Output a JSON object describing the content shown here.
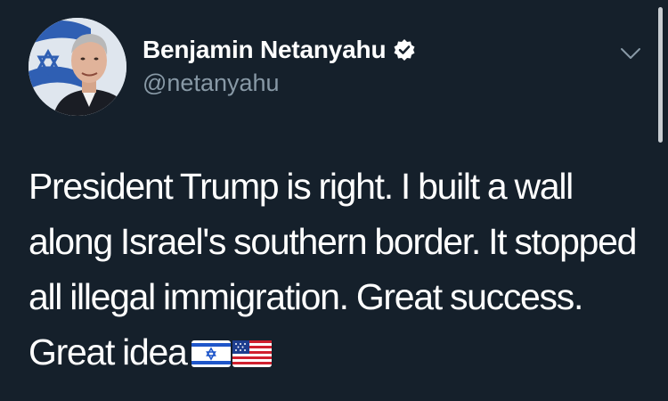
{
  "tweet": {
    "author": {
      "display_name": "Benjamin Netanyahu",
      "handle": "@netanyahu",
      "verified": true,
      "avatar_icon": "portrait-with-israeli-flag"
    },
    "text": "President Trump is right. I built a wall along Israel's southern border. It stopped all illegal immigration. Great success. Great idea",
    "emojis": [
      "israel-flag-emoji",
      "us-flag-emoji"
    ],
    "menu_icon": "chevron-down-icon"
  },
  "colors": {
    "background": "#15202b",
    "primary_text": "#ffffff",
    "secondary_text": "#8899a6",
    "verified_badge": "#ffffff"
  }
}
